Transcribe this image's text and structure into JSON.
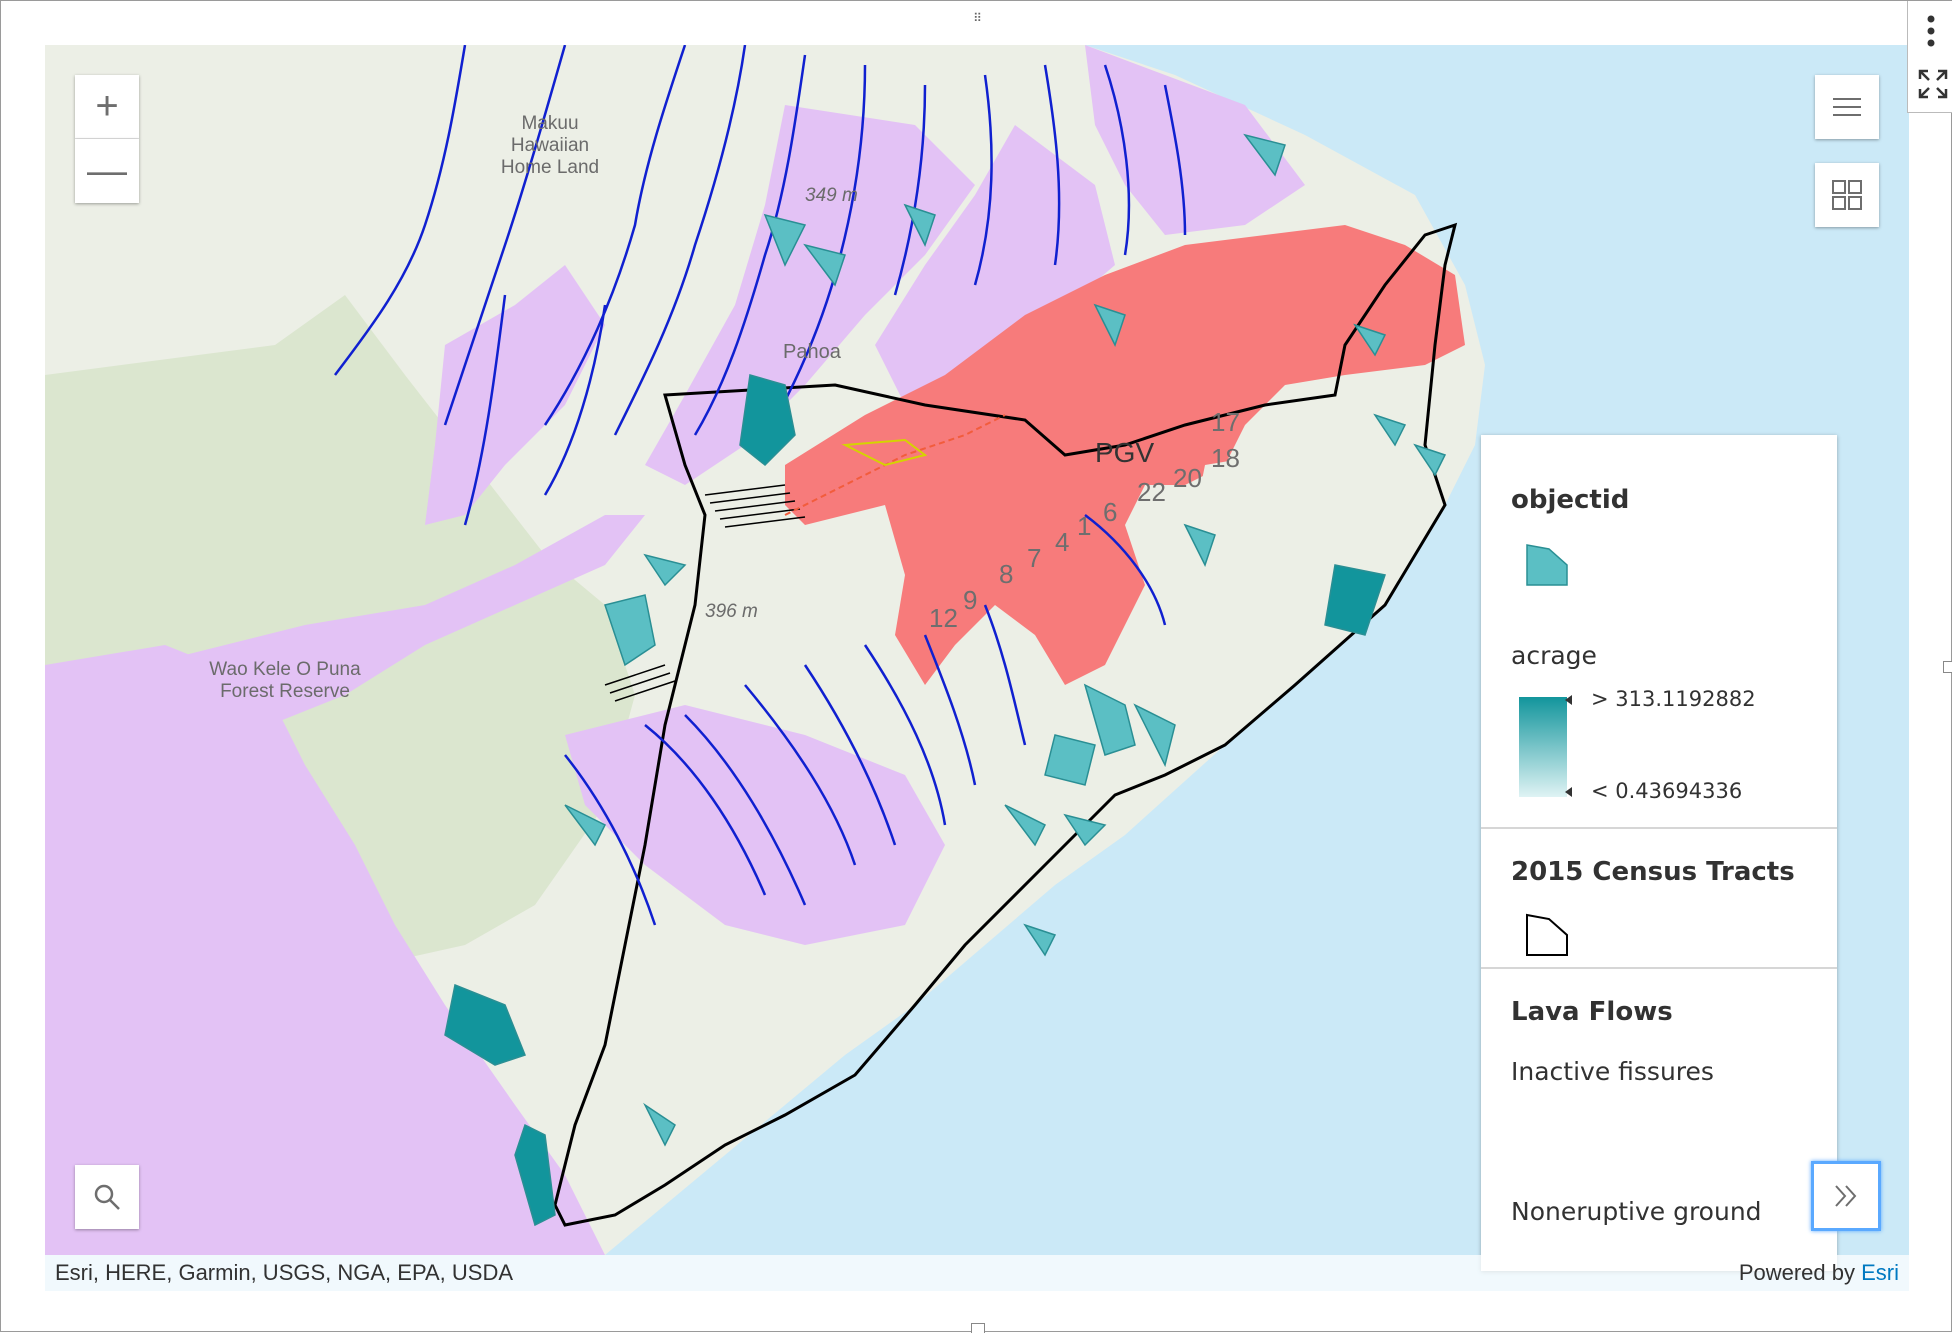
{
  "map": {
    "labels": {
      "makuu": "Makuu Hawaiian Home Land",
      "elevation_top": "349 m",
      "pahoa": "Pahoa",
      "elevation_mid": "396 m",
      "wao_kele": "Wao Kele O Puna Forest Reserve",
      "pgv": "PGV"
    },
    "fissure_numbers": [
      "17",
      "18",
      "20",
      "22",
      "6",
      "1",
      "4",
      "7",
      "8",
      "9",
      "12"
    ]
  },
  "controls": {
    "zoom_in": "+",
    "zoom_out": "—"
  },
  "attribution": {
    "sources": "Esri, HERE, Garmin, USGS, NGA, EPA, USDA",
    "powered_prefix": "Powered by ",
    "powered_brand": "Esri"
  },
  "legend": {
    "layer1_title": "objectid",
    "layer1_sub": "acrage",
    "acrage_max": "> 313.1192882",
    "acrage_min": "< 0.43694336",
    "layer2_title": "2015 Census Tracts",
    "layer3_title": "Lava Flows",
    "lava_item1": "Inactive fissures",
    "lava_item2": "Noneruptive ground"
  },
  "colors": {
    "ocean": "#cbe9f7",
    "land": "#ecefe6",
    "forest": "#dbe6cf",
    "lava_zone": "#e3c2f5",
    "active_lava": "#f77b7b",
    "parcel_fill": "#5bbfc4",
    "parcel_dark": "#12959c",
    "stream": "#1020d0",
    "tract_line": "#000000"
  },
  "icons": {
    "search": "search-icon",
    "legend": "legend-list-icon",
    "basemap": "basemap-gallery-icon",
    "collapse": "double-chevron-right-icon",
    "more": "vertical-dots-icon",
    "expand": "expand-arrows-icon"
  }
}
